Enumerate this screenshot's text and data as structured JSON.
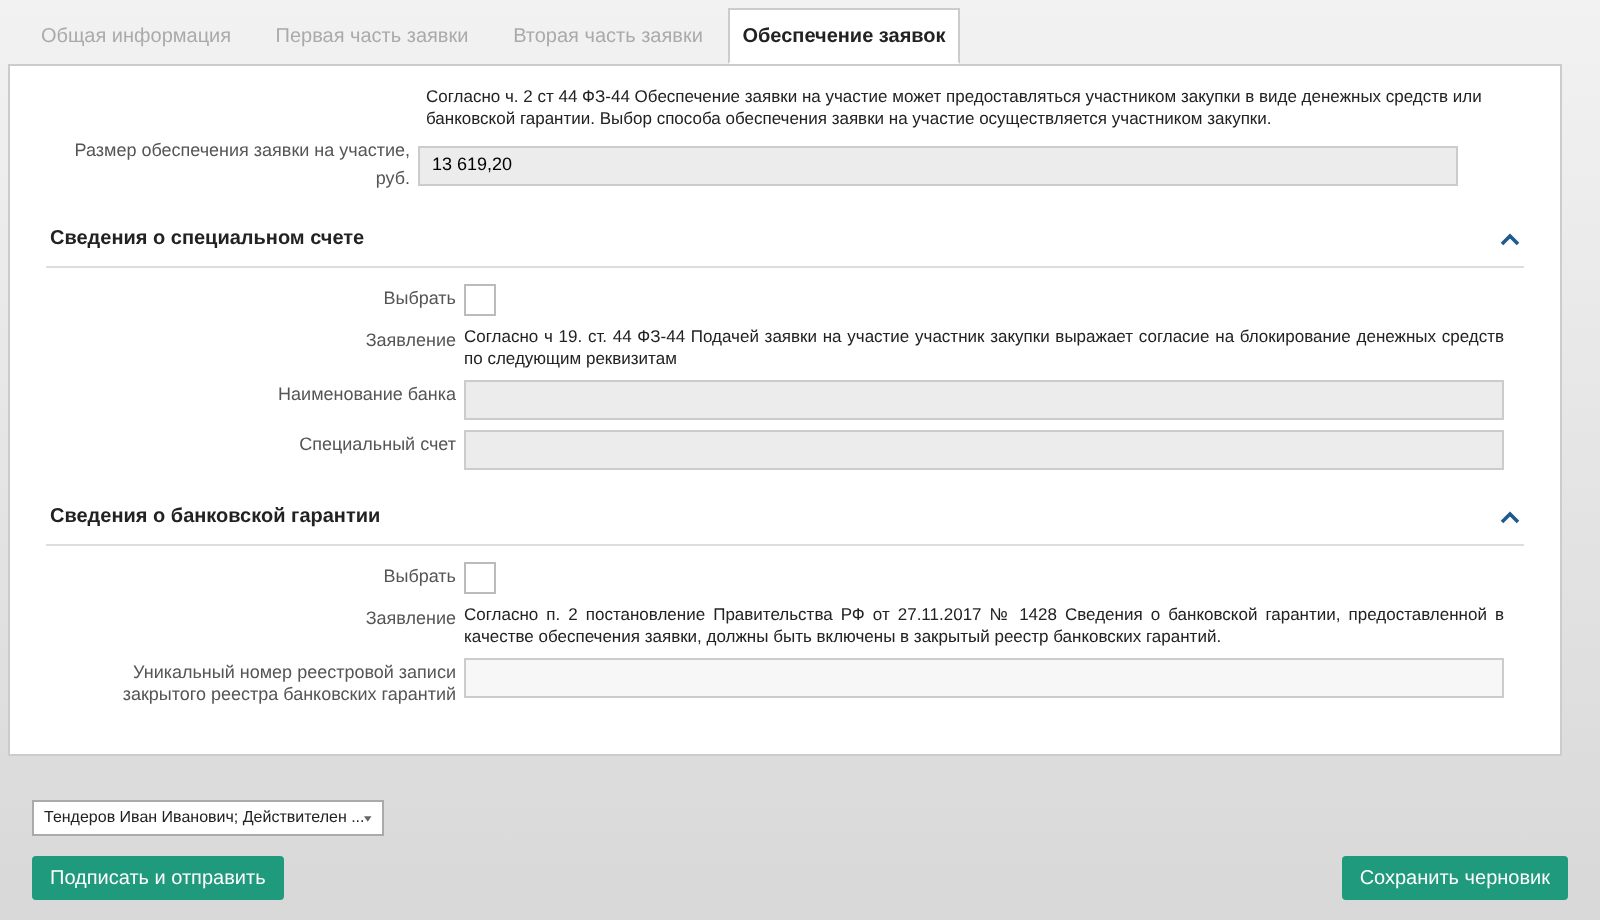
{
  "tabs": [
    {
      "label": "Общая информация",
      "selected": false
    },
    {
      "label": "Первая часть заявки",
      "selected": false
    },
    {
      "label": "Вторая часть заявки",
      "selected": false
    },
    {
      "label": "Обеспечение заявок",
      "selected": true
    }
  ],
  "intro": {
    "note": "Согласно ч. 2 ст 44 ФЗ-44 Обеспечение заявки на участие может предоставляться участником закупки в виде денежных средств или банковской гарантии. Выбор способа обеспечения заявки на участие осуществляется участником закупки.",
    "amount_label": "Размер обеспечения заявки на участие, руб.",
    "amount_value": "13 619,20"
  },
  "sections": [
    {
      "title": "Сведения о специальном счете",
      "expanded": true,
      "rows": [
        {
          "kind": "checkbox",
          "label": "Выбрать",
          "checked": false
        },
        {
          "kind": "text",
          "label": "Заявление",
          "text": "Согласно ч 19. ст. 44 ФЗ-44 Подачей заявки на участие участник закупки выражает согласие на блокирование денежных средств по следующим реквизитам"
        },
        {
          "kind": "field",
          "label": "Наименование банка",
          "disabled": true
        },
        {
          "kind": "field",
          "label": "Специальный счет",
          "disabled": true
        }
      ]
    },
    {
      "title": "Сведения о банковской гарантии",
      "expanded": true,
      "rows": [
        {
          "kind": "checkbox",
          "label": "Выбрать",
          "checked": false
        },
        {
          "kind": "text",
          "label": "Заявление",
          "text": "Согласно п. 2 постановление Правительства РФ от 27.11.2017 № 1428 Сведения о банковской гарантии, предоставленной в качестве обеспечения заявки, должны быть включены в закрытый реестр банковских гарантий."
        },
        {
          "kind": "field",
          "label": "Уникальный номер реестровой записи закрытого реестра банковских гарантий",
          "disabled": false
        }
      ]
    }
  ],
  "certificate": {
    "value": "Тендеров Иван Иванович; Действителен ..."
  },
  "buttons": {
    "submit": "Подписать и отправить",
    "save": "Сохранить черновик"
  }
}
